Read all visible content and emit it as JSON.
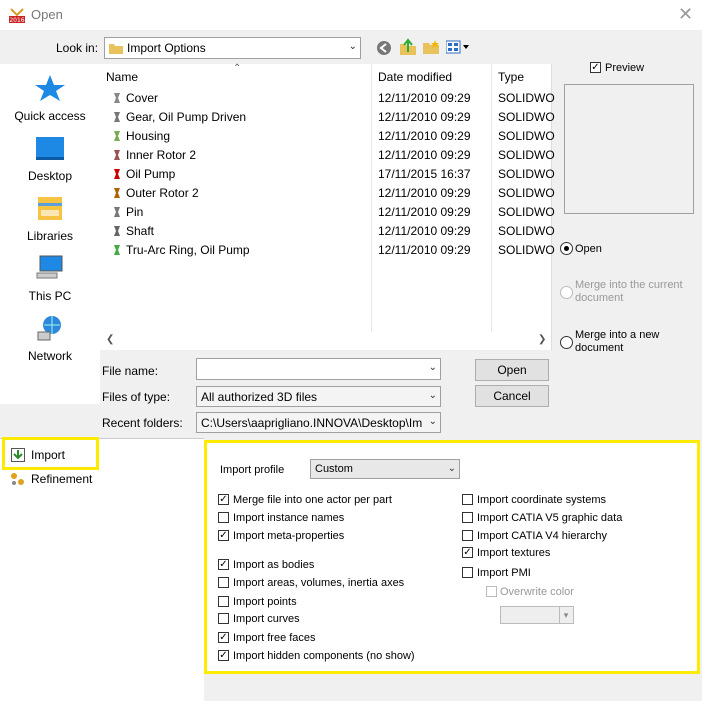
{
  "window": {
    "title": "Open",
    "app_badge": "2016"
  },
  "toolbar": {
    "look_in_label": "Look in:",
    "look_in_value": "Import Options",
    "icons": [
      "back-icon",
      "up-folder-icon",
      "new-folder-icon",
      "view-menu-icon"
    ]
  },
  "places": [
    {
      "label": "Quick access",
      "icon": "star-icon"
    },
    {
      "label": "Desktop",
      "icon": "desktop-icon"
    },
    {
      "label": "Libraries",
      "icon": "libraries-icon"
    },
    {
      "label": "This PC",
      "icon": "computer-icon"
    },
    {
      "label": "Network",
      "icon": "network-icon"
    }
  ],
  "filelist": {
    "columns": {
      "name": "Name",
      "date": "Date modified",
      "type": "Type"
    },
    "rows": [
      {
        "name": "Cover",
        "date": "12/11/2010 09:29",
        "type": "SOLIDWO"
      },
      {
        "name": "Gear, Oil Pump Driven",
        "date": "12/11/2010 09:29",
        "type": "SOLIDWO"
      },
      {
        "name": "Housing",
        "date": "12/11/2010 09:29",
        "type": "SOLIDWO"
      },
      {
        "name": "Inner Rotor 2",
        "date": "12/11/2010 09:29",
        "type": "SOLIDWO"
      },
      {
        "name": "Oil Pump",
        "date": "17/11/2015 16:37",
        "type": "SOLIDWO"
      },
      {
        "name": "Outer Rotor 2",
        "date": "12/11/2010 09:29",
        "type": "SOLIDWO"
      },
      {
        "name": "Pin",
        "date": "12/11/2010 09:29",
        "type": "SOLIDWO"
      },
      {
        "name": "Shaft",
        "date": "12/11/2010 09:29",
        "type": "SOLIDWO"
      },
      {
        "name": "Tru-Arc Ring, Oil Pump",
        "date": "12/11/2010 09:29",
        "type": "SOLIDWO"
      }
    ]
  },
  "fields": {
    "file_name_label": "File name:",
    "file_name_value": "",
    "files_of_type_label": "Files of type:",
    "files_of_type_value": "All authorized 3D files",
    "recent_folders_label": "Recent folders:",
    "recent_folders_value": "C:\\Users\\aaprigliano.INNOVA\\Desktop\\Import"
  },
  "buttons": {
    "open": "Open",
    "cancel": "Cancel"
  },
  "right_panel": {
    "preview_label": "Preview",
    "preview_checked": true,
    "open_label": "Open",
    "merge_current_label": "Merge into the current document",
    "merge_new_label": "Merge into a new document"
  },
  "nav_tree": {
    "import": "Import",
    "refinement": "Refinement"
  },
  "options": {
    "profile_label": "Import profile",
    "profile_value": "Custom",
    "left": [
      {
        "label": "Merge file into one actor per part",
        "checked": true
      },
      {
        "label": "Import instance names",
        "checked": false
      },
      {
        "label": "Import meta-properties",
        "checked": true
      },
      {
        "label": "Import as bodies",
        "checked": true
      },
      {
        "label": "Import areas, volumes, inertia axes",
        "checked": false
      },
      {
        "label": "Import points",
        "checked": false
      },
      {
        "label": "Import curves",
        "checked": false
      },
      {
        "label": "Import free faces",
        "checked": true
      },
      {
        "label": "Import hidden components (no show)",
        "checked": true
      }
    ],
    "right": [
      {
        "label": "Import coordinate systems",
        "checked": false
      },
      {
        "label": "Import CATIA V5 graphic data",
        "checked": false
      },
      {
        "label": "Import CATIA V4 hierarchy",
        "checked": false
      },
      {
        "label": "Import textures",
        "checked": true
      },
      {
        "label": "Import PMI",
        "checked": false
      }
    ],
    "overwrite_color_label": "Overwrite color",
    "highlight_color": "#ffeb00"
  }
}
